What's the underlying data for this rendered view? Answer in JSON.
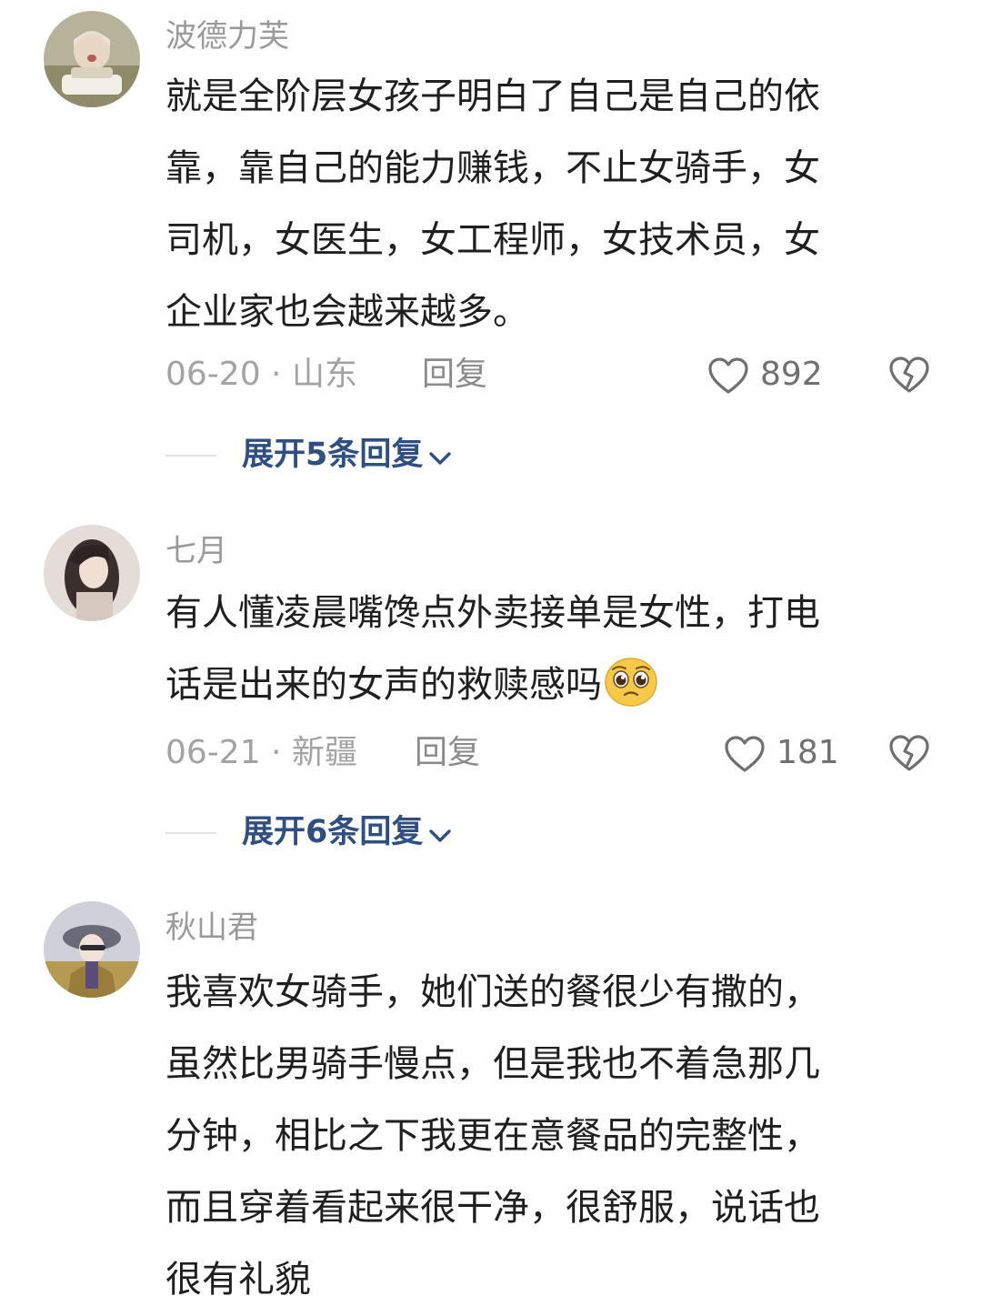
{
  "comments": [
    {
      "username": "波德力芙",
      "lines": [
        "就是全阶层女孩子明白了自己是自己的依",
        "靠，靠自己的能力赚钱，不止女骑手，女",
        "司机，女医生，女工程师，女技术员，女",
        "企业家也会越来越多。"
      ],
      "date_location": "06-20 · 山东",
      "reply_label": "回复",
      "likes": "892",
      "expand_label": "展开5条回复"
    },
    {
      "username": "七月",
      "lines": [
        "有人懂凌晨嘴馋点外卖接单是女性，打电",
        "话是出来的女声的救赎感吗"
      ],
      "emoji": "pleading-face",
      "date_location": "06-21 · 新疆",
      "reply_label": "回复",
      "likes": "181",
      "expand_label": "展开6条回复"
    },
    {
      "username": "秋山君",
      "lines": [
        "我喜欢女骑手，她们送的餐很少有撒的，",
        "虽然比男骑手慢点，但是我也不着急那几",
        "分钟，相比之下我更在意餐品的完整性，",
        "而且穿着看起来很干净，很舒服，说话也",
        "很有礼貌"
      ]
    }
  ],
  "icons": {
    "like": "heart-outline-icon",
    "dislike": "broken-heart-icon",
    "expand": "chevron-down-icon"
  },
  "colors": {
    "username": "#9a9a9a",
    "body": "#1f1f1f",
    "meta": "#a3a3a3",
    "expand": "#2f4f83"
  }
}
